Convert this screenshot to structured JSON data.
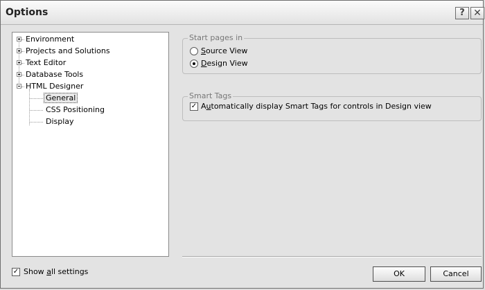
{
  "window": {
    "title": "Options"
  },
  "titlebar": {
    "help_glyph": "?",
    "close_glyph": "✕"
  },
  "tree": {
    "items": [
      {
        "label": "Environment",
        "state": "collapsed"
      },
      {
        "label": "Projects and Solutions",
        "state": "collapsed"
      },
      {
        "label": "Text Editor",
        "state": "collapsed"
      },
      {
        "label": "Database Tools",
        "state": "collapsed"
      },
      {
        "label": "HTML Designer",
        "state": "expanded",
        "children": [
          {
            "label": "General",
            "selected": true
          },
          {
            "label": "CSS Positioning"
          },
          {
            "label": "Display"
          }
        ]
      }
    ]
  },
  "start_pages": {
    "legend": "Start pages in",
    "source_pre": "",
    "source_acc": "S",
    "source_post": "ource View",
    "design_pre": "",
    "design_acc": "D",
    "design_post": "esign View",
    "selected": "Design View"
  },
  "smart_tags": {
    "legend": "Smart Tags",
    "auto_pre": "A",
    "auto_acc": "u",
    "auto_post": "tomatically display Smart Tags for controls in Design view",
    "checked": true
  },
  "footer": {
    "show_all_pre": "Show ",
    "show_all_acc": "a",
    "show_all_post": "ll settings",
    "show_all_checked": true,
    "ok_label": "OK",
    "cancel_label": "Cancel"
  }
}
